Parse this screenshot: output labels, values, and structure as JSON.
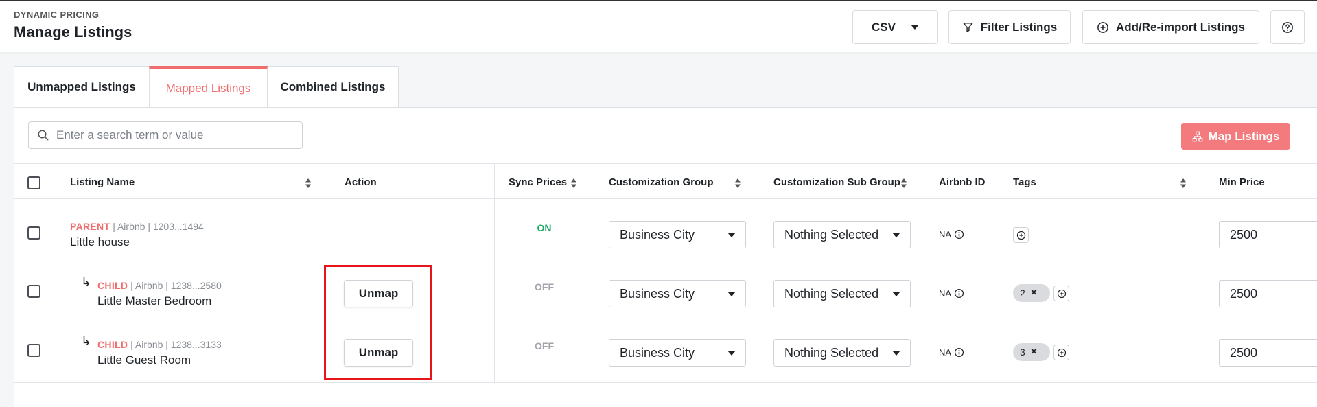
{
  "header": {
    "eyebrow": "DYNAMIC PRICING",
    "title": "Manage Listings",
    "csv_label": "CSV",
    "filter_label": "Filter Listings",
    "add_label": "Add/Re-import Listings"
  },
  "tabs": [
    {
      "label": "Unmapped Listings",
      "active": false
    },
    {
      "label": "Mapped Listings",
      "active": true
    },
    {
      "label": "Combined Listings",
      "active": false
    }
  ],
  "search": {
    "placeholder": "Enter a search term or value",
    "value": ""
  },
  "map_button_label": "Map Listings",
  "columns": {
    "listing_name": "Listing Name",
    "action": "Action",
    "sync_prices": "Sync Prices",
    "customization_group": "Customization Group",
    "customization_sub_group": "Customization Sub Group",
    "airbnb_id": "Airbnb ID",
    "tags": "Tags",
    "min_price": "Min Price"
  },
  "rows": [
    {
      "role": "PARENT",
      "meta": " | Airbnb | 1203...1494",
      "name": "Little house",
      "action": "",
      "sync": "ON",
      "group": "Business City",
      "sub_group": "Nothing Selected",
      "airbnb_id": "NA",
      "tag_count": "",
      "min_price": "2500"
    },
    {
      "role": "CHILD",
      "meta": " | Airbnb | 1238...2580",
      "name": "Little Master Bedroom",
      "action": "Unmap",
      "sync": "OFF",
      "group": "Business City",
      "sub_group": "Nothing Selected",
      "airbnb_id": "NA",
      "tag_count": "2",
      "min_price": "2500"
    },
    {
      "role": "CHILD",
      "meta": " | Airbnb | 1238...3133",
      "name": "Little Guest Room",
      "action": "Unmap",
      "sync": "OFF",
      "group": "Business City",
      "sub_group": "Nothing Selected",
      "airbnb_id": "NA",
      "tag_count": "3",
      "min_price": "2500"
    }
  ],
  "colors": {
    "accent": "#f06d6d",
    "on": "#1fa865",
    "highlight": "#e8141c"
  }
}
